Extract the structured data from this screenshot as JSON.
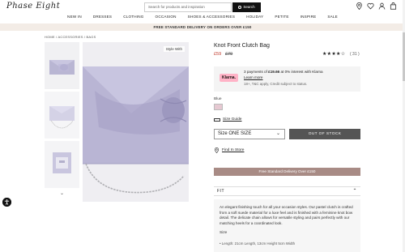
{
  "header": {
    "logo": "Phase Eight",
    "search_placeholder": "Search for products and inspiration",
    "search_button": "Search",
    "icons": [
      "location-pin-icon",
      "heart-icon",
      "user-icon",
      "bag-icon"
    ]
  },
  "nav": {
    "items": [
      "NEW IN",
      "DRESSES",
      "CLOTHING",
      "OCCASION",
      "SHOES & ACCESSORIES",
      "HOLIDAY",
      "PETITE",
      "INSPIRE",
      "SALE"
    ]
  },
  "promo": "FREE STANDARD DELIVERY ON ORDERS OVER £150",
  "breadcrumb": "HOME / ACCESSORIES / BAGS",
  "gallery": {
    "style_with": "Style With",
    "thumb_down_arrow": "⌄"
  },
  "product": {
    "title": "Knot Front Clutch Bag",
    "price_now": "£59",
    "price_was": "£79",
    "rating_stars": "★★★★☆",
    "rating": 4.5,
    "review_count": "( 31 )",
    "colour_label": "Blue",
    "size_guide": "Size Guide",
    "size_value": "Size ONE SIZE",
    "size_chevron": "⌄",
    "out_of_stock": "OUT OF STOCK",
    "find_in_store": "Find In Store",
    "delivery_banner": "Free Standard Delivery Over £150"
  },
  "klarna": {
    "badge": "Klarna.",
    "line1_pre": "3 payments of ",
    "line1_amount": "£19.66",
    "line1_post": " at 0% interest with Klarna",
    "learn_more": "Learn more",
    "line3": "18+, T&C apply, Credit subject to status."
  },
  "fit": {
    "label": "FIT",
    "chevron": "⌃",
    "description": "An elegant finishing touch for all your occasion styles. Our pastel clutch is crafted from a soft suede material for a luxe feel and is finished with a feminine knot bow detail. The delicate chain allows for versatile styling and pairs perfectly with our matching heels for a coordinated look.",
    "size_heading": "Size",
    "dimensions": "• Length: 21cm Length, 13cm Height 5cm Width"
  },
  "colors": {
    "sale_price": "#c0392b",
    "klarna_pink": "#ffb3c7",
    "delivery_banner": "#a88b85",
    "promo_bg": "#f3ece6",
    "out_of_stock_bg": "#555555",
    "swatch": "#e6c9d2"
  }
}
